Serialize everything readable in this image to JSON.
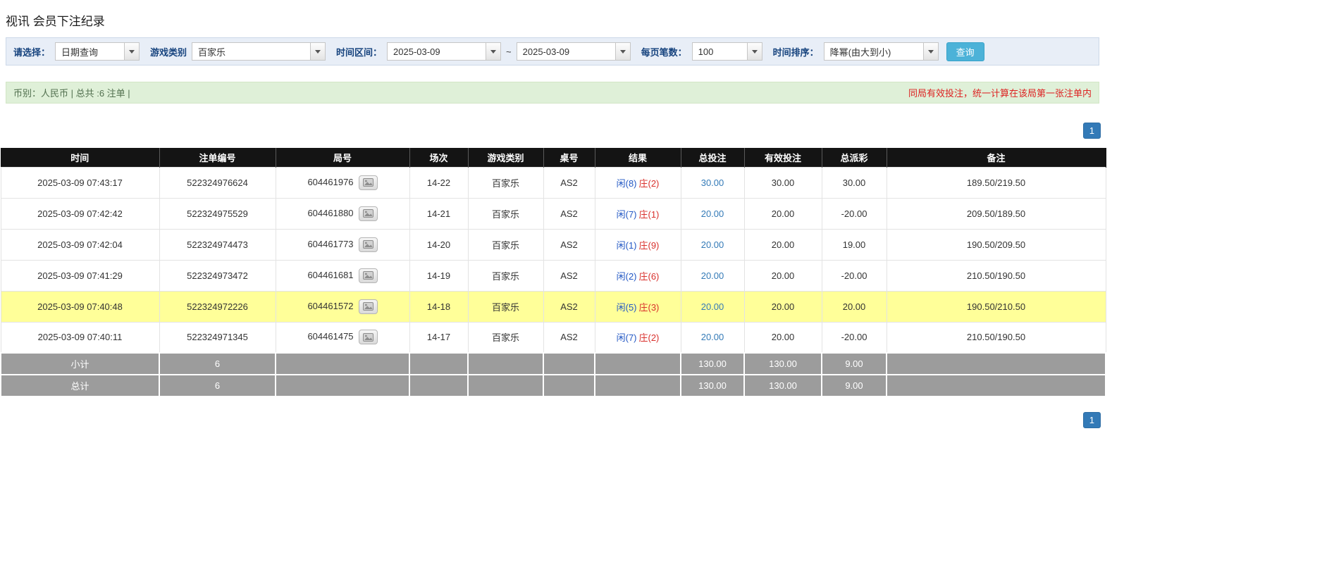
{
  "page": {
    "title": "视讯 会员下注纪录"
  },
  "filters": {
    "select_label": "请选择：",
    "select_value": "日期查询",
    "game_type_label": "游戏类别",
    "game_type_value": "百家乐",
    "time_range_label": "时间区间：",
    "date_from": "2025-03-09",
    "range_separator": "~",
    "date_to": "2025-03-09",
    "page_size_label": "每页笔数：",
    "page_size_value": "100",
    "sort_label": "时间排序：",
    "sort_value": "降幂(由大到小)",
    "search_button": "查询"
  },
  "summary": {
    "left": "币别：人民币 | 总共 :6 注单 |",
    "right": "同局有效投注，统一计算在该局第一张注单内"
  },
  "pagination": {
    "current_page": "1"
  },
  "colors": {
    "accent_blue": "#337ab7",
    "negative_red": "#e60000",
    "player_blue": "#2257c4",
    "banker_red": "#d9302c",
    "highlight_yellow": "#ffff99"
  },
  "table": {
    "headers": [
      "时间",
      "注单编号",
      "局号",
      "场次",
      "游戏类别",
      "桌号",
      "结果",
      "总投注",
      "有效投注",
      "总派彩",
      "备注"
    ],
    "rows": [
      {
        "time": "2025-03-09 07:43:17",
        "bet_id": "522324976624",
        "round_id": "604461976",
        "session": "14-22",
        "game_type": "百家乐",
        "table_no": "AS2",
        "result_player": "闲(8)",
        "result_banker": "庄(2)",
        "total_bet": "30.00",
        "valid_bet": "30.00",
        "payout": "30.00",
        "remark": "189.50/219.50",
        "highlight": false
      },
      {
        "time": "2025-03-09 07:42:42",
        "bet_id": "522324975529",
        "round_id": "604461880",
        "session": "14-21",
        "game_type": "百家乐",
        "table_no": "AS2",
        "result_player": "闲(7)",
        "result_banker": "庄(1)",
        "total_bet": "20.00",
        "valid_bet": "20.00",
        "payout": "-20.00",
        "remark": "209.50/189.50",
        "highlight": false
      },
      {
        "time": "2025-03-09 07:42:04",
        "bet_id": "522324974473",
        "round_id": "604461773",
        "session": "14-20",
        "game_type": "百家乐",
        "table_no": "AS2",
        "result_player": "闲(1)",
        "result_banker": "庄(9)",
        "total_bet": "20.00",
        "valid_bet": "20.00",
        "payout": "19.00",
        "remark": "190.50/209.50",
        "highlight": false
      },
      {
        "time": "2025-03-09 07:41:29",
        "bet_id": "522324973472",
        "round_id": "604461681",
        "session": "14-19",
        "game_type": "百家乐",
        "table_no": "AS2",
        "result_player": "闲(2)",
        "result_banker": "庄(6)",
        "total_bet": "20.00",
        "valid_bet": "20.00",
        "payout": "-20.00",
        "remark": "210.50/190.50",
        "highlight": false
      },
      {
        "time": "2025-03-09 07:40:48",
        "bet_id": "522324972226",
        "round_id": "604461572",
        "session": "14-18",
        "game_type": "百家乐",
        "table_no": "AS2",
        "result_player": "闲(5)",
        "result_banker": "庄(3)",
        "total_bet": "20.00",
        "valid_bet": "20.00",
        "payout": "20.00",
        "remark": "190.50/210.50",
        "highlight": true
      },
      {
        "time": "2025-03-09 07:40:11",
        "bet_id": "522324971345",
        "round_id": "604461475",
        "session": "14-17",
        "game_type": "百家乐",
        "table_no": "AS2",
        "result_player": "闲(7)",
        "result_banker": "庄(2)",
        "total_bet": "20.00",
        "valid_bet": "20.00",
        "payout": "-20.00",
        "remark": "210.50/190.50",
        "highlight": false
      }
    ],
    "subtotal_row": {
      "label": "小计",
      "count": "6",
      "total_bet": "130.00",
      "valid_bet": "130.00",
      "payout": "9.00"
    },
    "total_row": {
      "label": "总计",
      "count": "6",
      "total_bet": "130.00",
      "valid_bet": "130.00",
      "payout": "9.00"
    }
  }
}
